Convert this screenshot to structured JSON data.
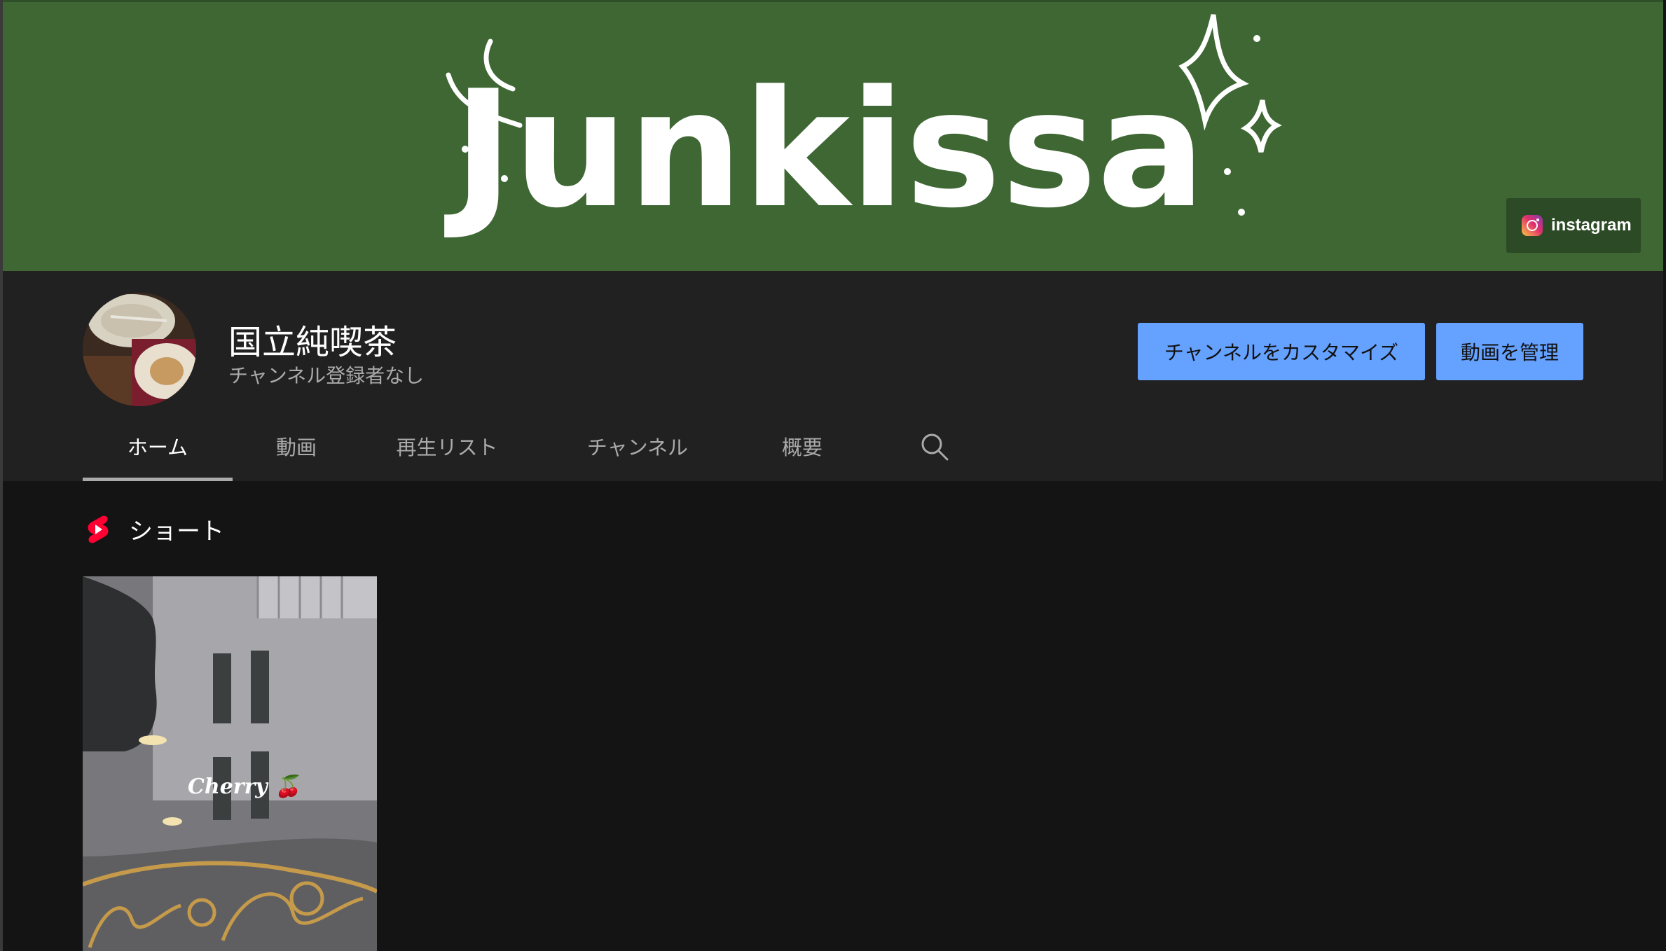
{
  "banner": {
    "title_art": "Junkissa",
    "link_label": "instagram",
    "link_icon": "instagram-icon",
    "background_color": "#3e6733"
  },
  "channel": {
    "name": "国立純喫茶",
    "subscribers": "チャンネル登録者なし"
  },
  "actions": {
    "customize_label": "チャンネルをカスタマイズ",
    "manage_label": "動画を管理",
    "button_color": "#65a1ff"
  },
  "tabs": [
    {
      "label": "ホーム",
      "active": true
    },
    {
      "label": "動画",
      "active": false
    },
    {
      "label": "再生リスト",
      "active": false
    },
    {
      "label": "チャンネル",
      "active": false
    },
    {
      "label": "概要",
      "active": false
    }
  ],
  "shorts": {
    "section_title": "ショート",
    "icon": "youtube-shorts-icon",
    "items": [
      {
        "thumbnail_text": "Cherry 🍒"
      }
    ]
  }
}
